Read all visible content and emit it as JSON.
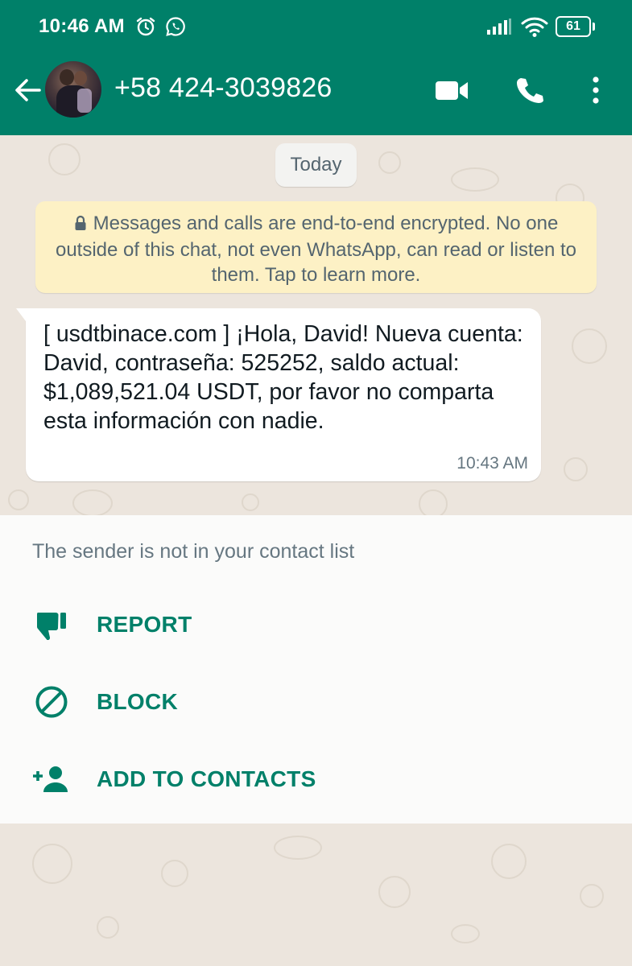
{
  "status_bar": {
    "time": "10:46 AM",
    "battery": "61",
    "icons": [
      "alarm-icon",
      "whatsapp-icon",
      "signal-icon",
      "wifi-icon",
      "battery-icon"
    ]
  },
  "header": {
    "contact": "+58 424-3039826",
    "icons": [
      "back-arrow-icon",
      "video-call-icon",
      "phone-icon",
      "more-vert-icon"
    ]
  },
  "chat": {
    "date_chip": "Today",
    "encryption_notice": "Messages and calls are end-to-end encrypted. No one outside of this chat, not even WhatsApp, can read or listen to them. Tap to learn more.",
    "message": {
      "text": "[ usdtbinace.com ] ¡Hola, David!  Nueva cuenta: David, contraseña: 525252, saldo actual: $1,089,521.04 USDT, por favor no comparta esta información con nadie.",
      "time": "10:43 AM"
    }
  },
  "unknown_sender_sheet": {
    "note": "The sender is not in your contact list",
    "actions": [
      {
        "label": "REPORT",
        "icon": "thumb-down-icon"
      },
      {
        "label": "BLOCK",
        "icon": "block-icon"
      },
      {
        "label": "ADD TO CONTACTS",
        "icon": "add-person-icon"
      }
    ]
  },
  "colors": {
    "primary": "#008069",
    "chat_background": "#ECE5DD",
    "encryption_banner": "#FDF1C5",
    "bubble": "#FFFFFF"
  }
}
